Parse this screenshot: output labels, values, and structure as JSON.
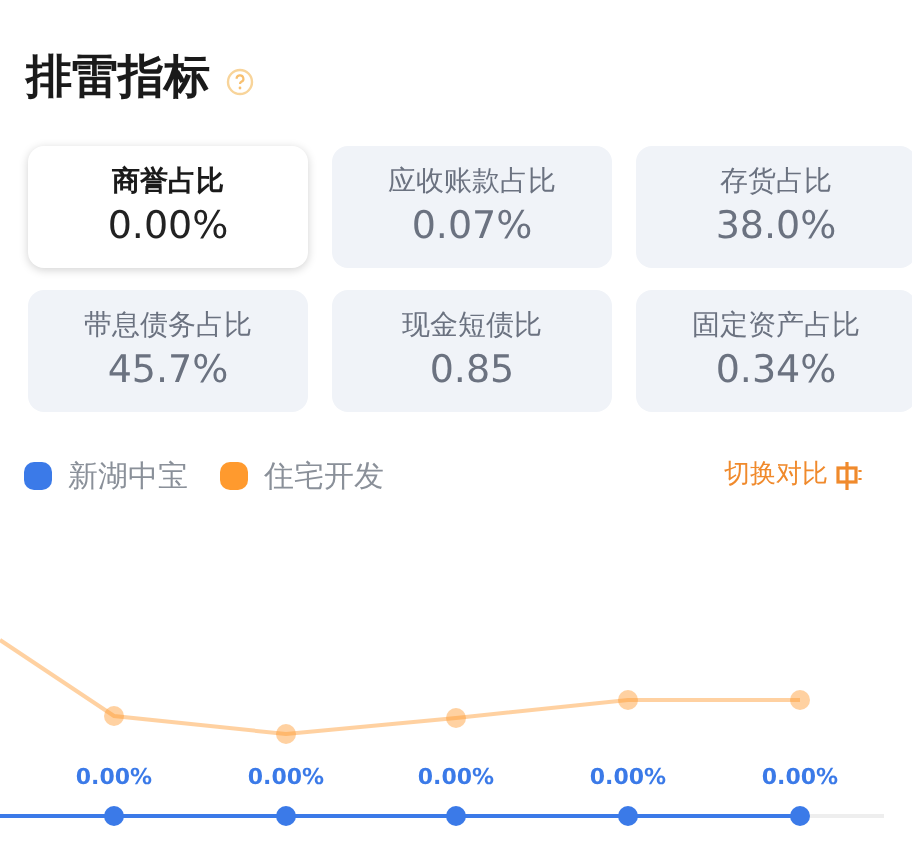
{
  "title": "排雷指标",
  "metrics": [
    {
      "label": "商誉占比",
      "value": "0.00%",
      "selected": true
    },
    {
      "label": "应收账款占比",
      "value": "0.07%",
      "selected": false
    },
    {
      "label": "存货占比",
      "value": "38.0%",
      "selected": false
    },
    {
      "label": "带息债务占比",
      "value": "45.7%",
      "selected": false
    },
    {
      "label": "现金短债比",
      "value": "0.85",
      "selected": false
    },
    {
      "label": "固定资产占比",
      "value": "0.34%",
      "selected": false
    }
  ],
  "legend": [
    {
      "name": "新湖中宝",
      "color": "#3b7ae8"
    },
    {
      "name": "住宅开发",
      "color": "#ff9a2e"
    }
  ],
  "switch_button": "切换对比",
  "value_labels": [
    "0.00%",
    "0.00%",
    "0.00%",
    "0.00%",
    "0.00%"
  ]
}
